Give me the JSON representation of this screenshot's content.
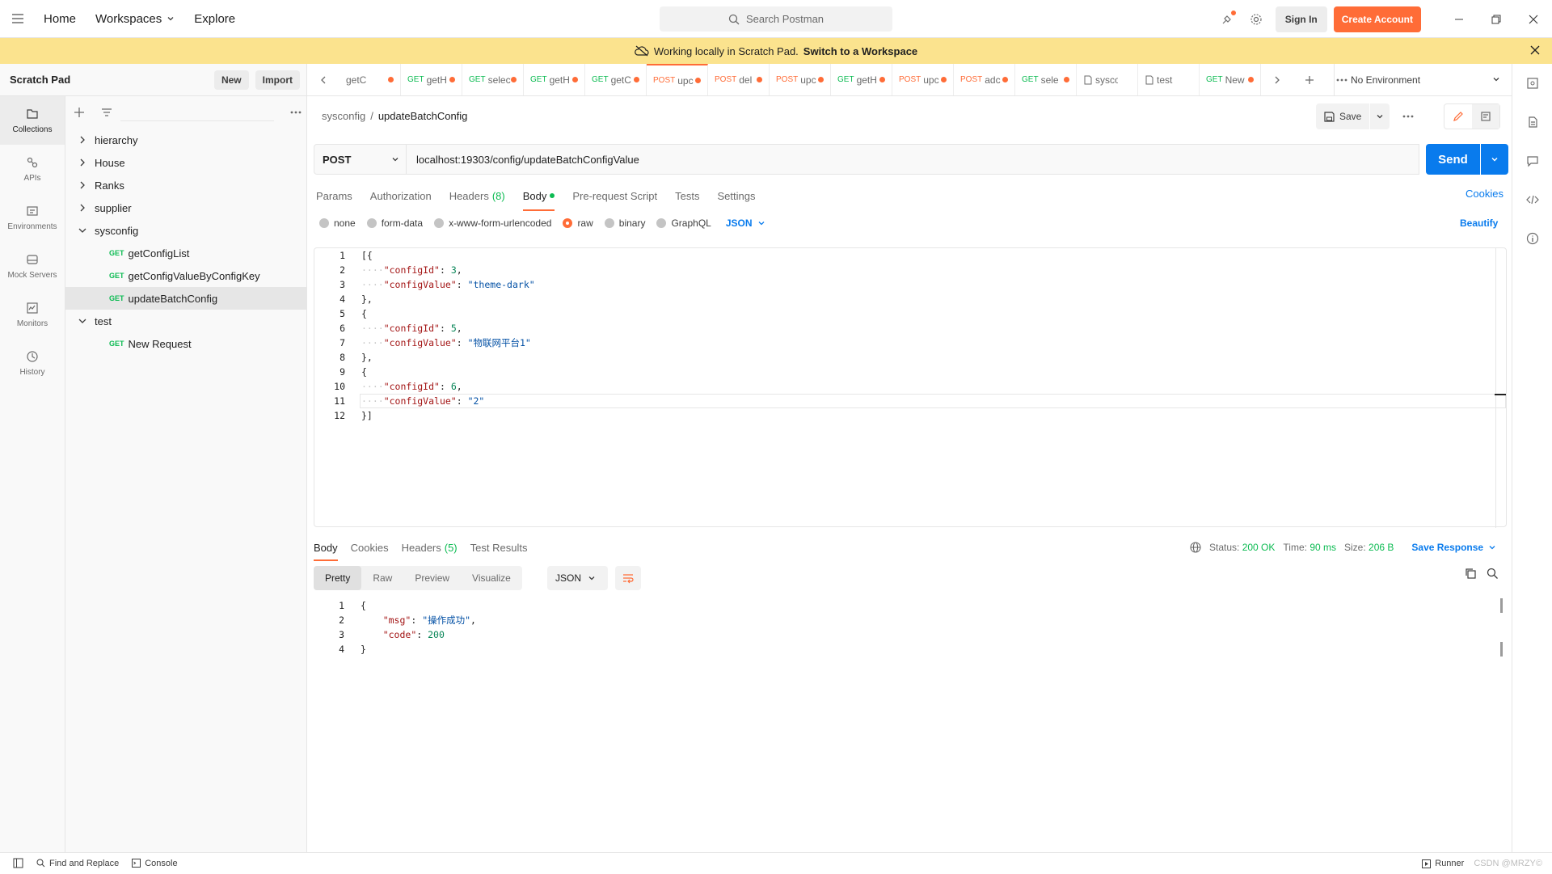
{
  "topbar": {
    "home": "Home",
    "workspaces": "Workspaces",
    "explore": "Explore",
    "search_placeholder": "Search Postman",
    "sign_in": "Sign In",
    "create_account": "Create Account"
  },
  "banner": {
    "text": "Working locally in Scratch Pad.",
    "link": "Switch to a Workspace"
  },
  "scratchpad": {
    "title": "Scratch Pad",
    "new_label": "New",
    "import_label": "Import"
  },
  "leftnav": [
    {
      "label": "Collections",
      "icon": "collections-icon"
    },
    {
      "label": "APIs",
      "icon": "apis-icon"
    },
    {
      "label": "Environments",
      "icon": "environments-icon"
    },
    {
      "label": "Mock Servers",
      "icon": "mock-servers-icon"
    },
    {
      "label": "Monitors",
      "icon": "monitors-icon"
    },
    {
      "label": "History",
      "icon": "history-icon"
    }
  ],
  "tree": {
    "folders": [
      "hierarchy",
      "House",
      "Ranks",
      "supplier",
      "sysconfig",
      "test"
    ],
    "sysconfig_requests": [
      {
        "method": "GET",
        "name": "getConfigList"
      },
      {
        "method": "GET",
        "name": "getConfigValueByConfigKey"
      },
      {
        "method": "GET",
        "name": "updateBatchConfig"
      }
    ],
    "test_requests": [
      {
        "method": "GET",
        "name": "New Request"
      }
    ]
  },
  "tabs": [
    {
      "method": "",
      "name": "getC"
    },
    {
      "method": "GET",
      "name": "getH"
    },
    {
      "method": "GET",
      "name": "selecti"
    },
    {
      "method": "GET",
      "name": "getH"
    },
    {
      "method": "GET",
      "name": "getC"
    },
    {
      "method": "POST",
      "name": "upc"
    },
    {
      "method": "POST",
      "name": "del"
    },
    {
      "method": "POST",
      "name": "upc"
    },
    {
      "method": "GET",
      "name": "getH"
    },
    {
      "method": "POST",
      "name": "upc"
    },
    {
      "method": "POST",
      "name": "adc"
    },
    {
      "method": "GET",
      "name": "sele"
    },
    {
      "method": "",
      "name": "syscon"
    },
    {
      "method": "",
      "name": "test"
    },
    {
      "method": "GET",
      "name": "New"
    }
  ],
  "environment": "No Environment",
  "breadcrumb": {
    "collection": "sysconfig",
    "separator": "/",
    "request": "updateBatchConfig"
  },
  "save_label": "Save",
  "request": {
    "method": "POST",
    "url": "localhost:19303/config/updateBatchConfigValue",
    "send_label": "Send"
  },
  "request_tabs": {
    "params": "Params",
    "authorization": "Authorization",
    "headers": "Headers",
    "headers_count": "(8)",
    "body": "Body",
    "prerequest": "Pre-request Script",
    "tests": "Tests",
    "settings": "Settings",
    "cookies": "Cookies"
  },
  "body_types": {
    "none": "none",
    "form_data": "form-data",
    "urlencoded": "x-www-form-urlencoded",
    "raw": "raw",
    "binary": "binary",
    "graphql": "GraphQL",
    "json": "JSON",
    "beautify": "Beautify"
  },
  "request_body": {
    "line_numbers": [
      "1",
      "2",
      "3",
      "4",
      "5",
      "6",
      "7",
      "8",
      "9",
      "10",
      "11",
      "12"
    ],
    "items": [
      {
        "configId": "3",
        "configValue": "\"theme-dark\""
      },
      {
        "configId": "5",
        "configValue": "\"物联网平台1\""
      },
      {
        "configId": "6",
        "configValue": "\"2\""
      }
    ]
  },
  "response_tabs": {
    "body": "Body",
    "cookies": "Cookies",
    "headers": "Headers",
    "headers_count": "(5)",
    "test_results": "Test Results"
  },
  "response_status": {
    "status_label": "Status:",
    "status": "200 OK",
    "time_label": "Time:",
    "time": "90 ms",
    "size_label": "Size:",
    "size": "206 B",
    "save_response": "Save Response"
  },
  "response_format": {
    "pretty": "Pretty",
    "raw": "Raw",
    "preview": "Preview",
    "visualize": "Visualize",
    "json": "JSON"
  },
  "response_body": {
    "line_numbers": [
      "1",
      "2",
      "3",
      "4"
    ],
    "msg_key": "\"msg\"",
    "msg_value": "\"操作成功\"",
    "code_key": "\"code\"",
    "code_value": "200"
  },
  "footer": {
    "find_replace": "Find and Replace",
    "console": "Console",
    "runner": "Runner",
    "watermark": "CSDN @MRZY©"
  },
  "colors": {
    "accent": "#ff6c37",
    "primary": "#097bed",
    "banner": "#fbe38e",
    "get": "#0cbb52"
  }
}
